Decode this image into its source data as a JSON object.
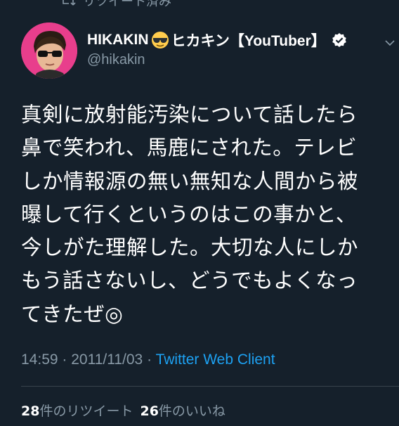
{
  "retweet_context": {
    "label": "リツイート済み",
    "icon": "retweet-icon"
  },
  "author": {
    "display_name": "HIKAKIN",
    "emoji": "sunglasses-emoji",
    "display_name_suffix": "ヒカキン【YouTuber】",
    "verified": true,
    "handle": "@hikakin",
    "avatar_bg": "#e83e8c"
  },
  "tweet": {
    "text": "真剣に放射能汚染について話したら\n鼻で笑われ、馬鹿にされた。テレビ\nしか情報源の無い無知な人間から被\n曝して行くというのはこの事かと、\n今しがた理解した。大切な人にしか\nもう話さないし、どうでもよくなっ\nてきたぜ◎",
    "time": "14:59",
    "separator": "·",
    "date": "2011/11/03",
    "client": "Twitter Web Client"
  },
  "stats": {
    "retweets_count": "28",
    "retweets_label": "件のリツイート",
    "likes_count": "26",
    "likes_label": "件のいいね"
  },
  "colors": {
    "background": "#15202b",
    "text": "#ffffff",
    "secondary": "#8899a6",
    "link": "#1da1f2",
    "divider": "#38444d"
  }
}
